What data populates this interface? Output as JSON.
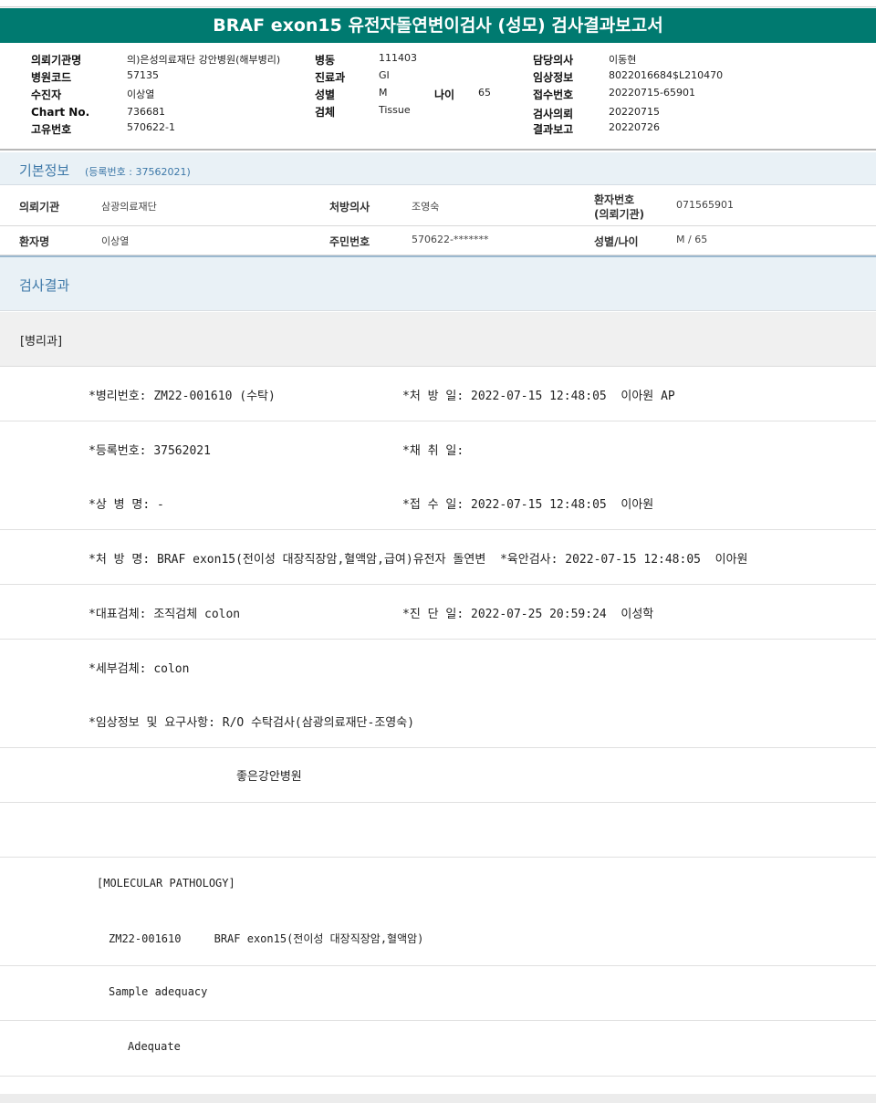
{
  "title": "BRAF exon15 유전자돌연변이검사 (성모) 검사결과보고서",
  "header": {
    "col1": [
      {
        "label": "의뢰기관명",
        "value": "의)은성의료재단 강안병원(해부병리)"
      },
      {
        "label": "병원코드",
        "value": "57135"
      },
      {
        "label": "수진자",
        "value": "이상열"
      },
      {
        "label": "Chart No.",
        "value": "736681"
      },
      {
        "label": "고유번호",
        "value": "570622-1"
      }
    ],
    "col2": [
      {
        "label": "병동",
        "value": "111403"
      },
      {
        "label": "진료과",
        "value": "GI"
      },
      {
        "label": "성별",
        "value": "M"
      },
      {
        "label": "검체",
        "value": "Tissue"
      }
    ],
    "age": {
      "label": "나이",
      "value": "65"
    },
    "col3": [
      {
        "label": "담당의사",
        "value": "이동현"
      },
      {
        "label": "임상정보",
        "value": "8022016684$L210470"
      },
      {
        "label": "접수번호",
        "value": "20220715-65901"
      },
      {
        "label": "검사의뢰",
        "value": "20220715"
      },
      {
        "label": "결과보고",
        "value": "20220726"
      }
    ]
  },
  "basic": {
    "title": "기본정보",
    "sub": "(등록번호 : 37562021)",
    "r1": {
      "k1": "의뢰기관",
      "v1": "삼광의료재단",
      "k2": "처방의사",
      "v2": "조영숙",
      "k3a": "환자번호",
      "k3b": "(의뢰기관)",
      "v3": "071565901"
    },
    "r2": {
      "k1": "환자명",
      "v1": "이상열",
      "k2": "주민번호",
      "v2": "570622-*******",
      "k3": "성별/나이",
      "v3": "M / 65"
    }
  },
  "result": {
    "title": "검사결과",
    "dept": "[병리과]",
    "lines": [
      {
        "a": "*병리번호: ZM22-001610 (수탁)",
        "b": "*처 방 일: 2022-07-15 12:48:05  이아원 AP"
      },
      {
        "a": "*등록번호: 37562021",
        "b": "*채 취 일:"
      },
      {
        "a": "*상 병 명: -",
        "b": "*접 수 일: 2022-07-15 12:48:05  이아원"
      },
      {
        "a": "*처 방 명: BRAF exon15(전이성 대장직장암,혈액암,급여)유전자 돌연변  *육안검사: 2022-07-15 12:48:05  이아원",
        "b": ""
      },
      {
        "a": "*대표검체: 조직검체 colon",
        "b": "*진 단 일: 2022-07-25 20:59:24  이성학"
      },
      {
        "a": "*세부검체: colon",
        "b": ""
      },
      {
        "a": "*임상정보 및 요구사항: R/O 수탁검사(삼광의료재단-조영숙)",
        "b": ""
      },
      {
        "a": "좋은강안병원",
        "b": ""
      },
      {
        "a": "",
        "b": ""
      },
      {
        "a": "[MOLECULAR PATHOLOGY]",
        "b": ""
      },
      {
        "a": "ZM22-001610     BRAF exon15(전이성 대장직장암,혈액암)",
        "b": ""
      },
      {
        "a": "Sample adequacy",
        "b": ""
      },
      {
        "a": "Adequate",
        "b": ""
      }
    ]
  }
}
